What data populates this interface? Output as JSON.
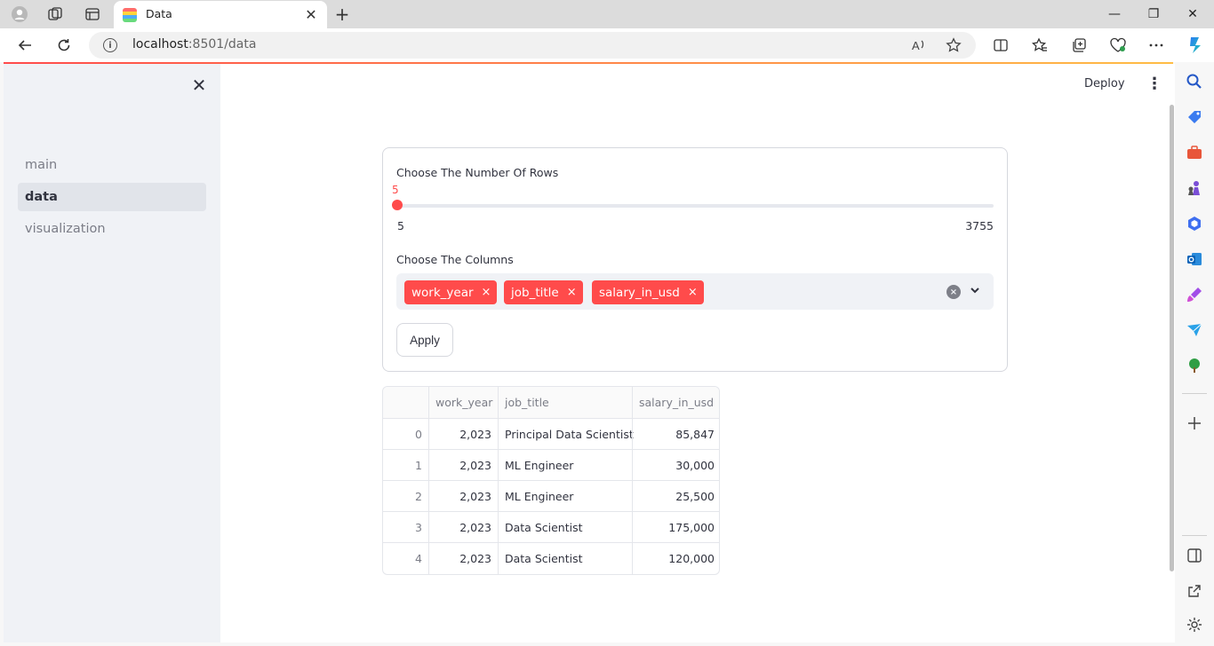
{
  "browser": {
    "tab_title": "Data",
    "tab_close": "✕",
    "new_tab": "+",
    "url_host": "localhost",
    "url_port_path": ":8501/data",
    "icons": [
      "profile-icon",
      "workspaces-icon",
      "tab-actions-icon",
      "back-icon",
      "refresh-icon",
      "info-icon",
      "read-aloud-icon",
      "favorite-star-icon",
      "split-screen-icon",
      "favorites-icon",
      "collections-icon",
      "browser-essentials-icon",
      "more-icon",
      "copilot-icon"
    ],
    "window_buttons": {
      "minimize": "—",
      "restore": "❐",
      "close": "✕"
    }
  },
  "sidebar": {
    "close_icon": "✕",
    "items": [
      {
        "label": "main",
        "active": false
      },
      {
        "label": "data",
        "active": true
      },
      {
        "label": "visualization",
        "active": false
      }
    ]
  },
  "header": {
    "deploy_label": "Deploy",
    "menu_icon": "⋮"
  },
  "form": {
    "rows_label": "Choose The Number Of Rows",
    "slider": {
      "value": "5",
      "min": "5",
      "max": "3755"
    },
    "columns_label": "Choose The Columns",
    "selected_columns": [
      "work_year",
      "job_title",
      "salary_in_usd"
    ],
    "chip_remove": "×",
    "clear_icon": "×",
    "apply_label": "Apply"
  },
  "table": {
    "columns": [
      "",
      "work_year",
      "job_title",
      "salary_in_usd"
    ],
    "rows": [
      [
        "0",
        "2,023",
        "Principal Data Scientist",
        "85,847"
      ],
      [
        "1",
        "2,023",
        "ML Engineer",
        "30,000"
      ],
      [
        "2",
        "2,023",
        "ML Engineer",
        "25,500"
      ],
      [
        "3",
        "2,023",
        "Data Scientist",
        "175,000"
      ],
      [
        "4",
        "2,023",
        "Data Scientist",
        "120,000"
      ]
    ]
  },
  "colors": {
    "accent": "#ff4b4b",
    "sidebar_bg": "#f0f2f6",
    "text": "#31333f"
  }
}
